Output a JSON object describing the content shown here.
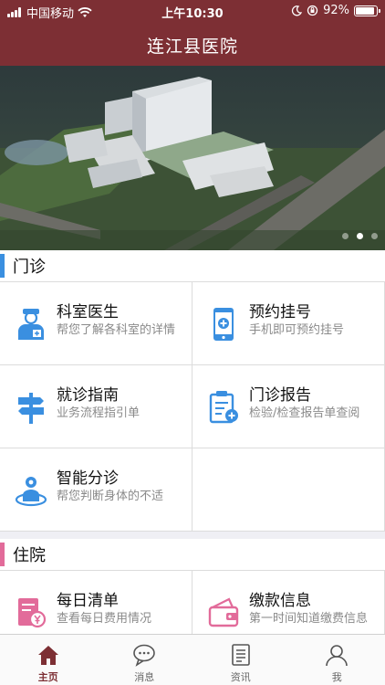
{
  "status_bar": {
    "carrier": "中国移动",
    "time": "上午10:30",
    "battery": "92%",
    "battery_level": 0.92
  },
  "app": {
    "title": "连江县医院"
  },
  "banner": {
    "slide_count": 3,
    "active_slide": 2
  },
  "outpatient": {
    "title": "门诊",
    "accent": "#3a8fe0",
    "items": [
      {
        "title": "科室医生",
        "desc": "帮您了解各科室的详情",
        "icon": "doctor-icon"
      },
      {
        "title": "预约挂号",
        "desc": "手机即可预约挂号",
        "icon": "phone-medical-icon"
      },
      {
        "title": "就诊指南",
        "desc": "业务流程指引单",
        "icon": "signpost-icon"
      },
      {
        "title": "门诊报告",
        "desc": "检验/检查报告单查阅",
        "icon": "clipboard-report-icon"
      },
      {
        "title": "智能分诊",
        "desc": "帮您判断身体的不适",
        "icon": "body-scan-icon"
      }
    ]
  },
  "inpatient": {
    "title": "住院",
    "accent": "#e26b9a",
    "items": [
      {
        "title": "每日清单",
        "desc": "查看每日费用情况",
        "icon": "daily-bill-icon"
      },
      {
        "title": "缴款信息",
        "desc": "第一时间知道缴费信息",
        "icon": "wallet-icon"
      }
    ]
  },
  "tabbar": {
    "items": [
      {
        "label": "主页",
        "icon": "home-icon",
        "active": true
      },
      {
        "label": "消息",
        "icon": "chat-icon",
        "active": false
      },
      {
        "label": "资讯",
        "icon": "news-icon",
        "active": false
      },
      {
        "label": "我",
        "icon": "user-icon",
        "active": false
      }
    ]
  },
  "colors": {
    "header": "#7d2f34",
    "blue_icon": "#3a8fe0",
    "pink_icon": "#e26b9a"
  }
}
